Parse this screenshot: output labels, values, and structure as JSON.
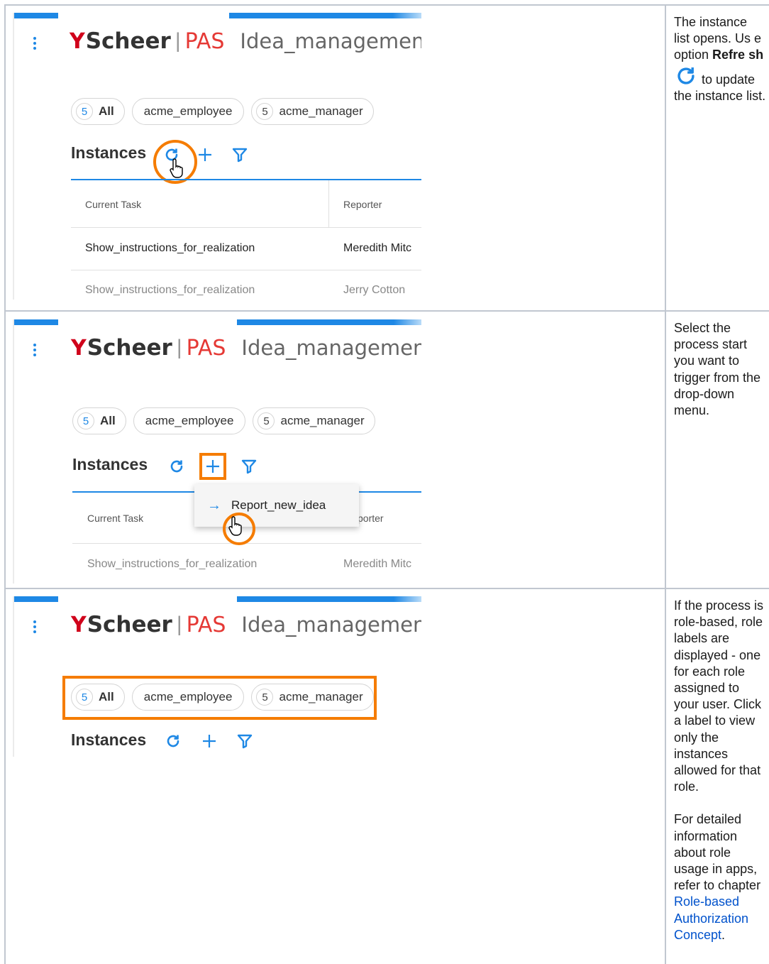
{
  "steps": [
    {
      "screenshot": {
        "brand": "Scheer",
        "product": "PAS",
        "app_name": "Idea_management",
        "chips": [
          {
            "count": "5",
            "label": "All"
          },
          {
            "count": "",
            "label": "acme_employee"
          },
          {
            "count": "5",
            "label": "acme_manager"
          }
        ],
        "heading": "Instances",
        "columns": [
          "Current Task",
          "Reporter"
        ],
        "rows": [
          [
            "Show_instructions_for_realization",
            "Meredith Mitc"
          ],
          [
            "Show_instructions_for_realization",
            "Jerry Cotton"
          ]
        ]
      },
      "description": {
        "part1": "The instance list opens. Us e option ",
        "bold": "Refre sh",
        "part2": " to update the instance list.",
        "icon": "refresh-icon"
      }
    },
    {
      "screenshot": {
        "brand": "Scheer",
        "product": "PAS",
        "app_name": "Idea_management",
        "chips": [
          {
            "count": "5",
            "label": "All"
          },
          {
            "count": "",
            "label": "acme_employee"
          },
          {
            "count": "5",
            "label": "acme_manager"
          }
        ],
        "heading": "Instances",
        "columns": [
          "Current Task",
          "porter"
        ],
        "rows": [
          [
            "Show_instructions_for_realization",
            "Meredith Mitc"
          ]
        ],
        "dropdown_item": "Report_new_idea"
      },
      "description": {
        "text": "Select the process start you want to trigger from the drop-down menu."
      }
    },
    {
      "screenshot": {
        "brand": "Scheer",
        "product": "PAS",
        "app_name": "Idea_management",
        "chips": [
          {
            "count": "5",
            "label": "All"
          },
          {
            "count": "",
            "label": "acme_employee"
          },
          {
            "count": "5",
            "label": "acme_manager"
          }
        ],
        "heading": "Instances"
      },
      "description": {
        "para1": "If the process is role-based, role labels are displayed - one for each role assigned to your user. Click a label to view only the instances allowed for that role.",
        "para2_text": "For detailed information about role usage in apps, refer to chapter ",
        "para2_link": "Role-based Authorization Concept",
        "para2_end": "."
      }
    }
  ],
  "colors": {
    "accent": "#1e88e5",
    "highlight": "#f57c00",
    "logo_red": "#d0021b",
    "link": "#0052cc"
  }
}
